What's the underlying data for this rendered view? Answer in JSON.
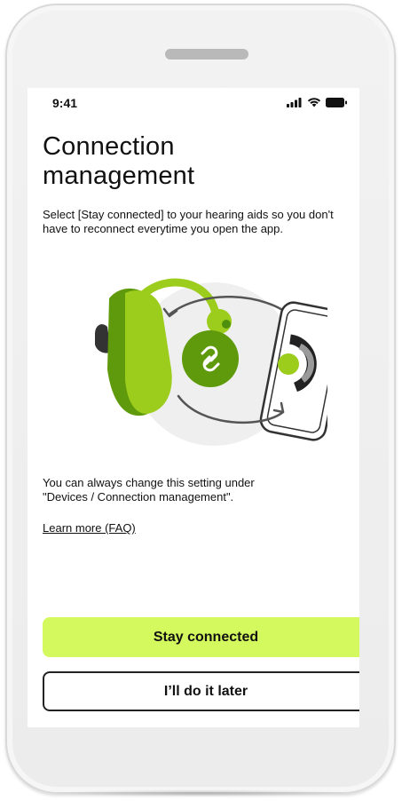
{
  "status_bar": {
    "time": "9:41",
    "icons": [
      "signal-icon",
      "wifi-icon",
      "battery-icon"
    ]
  },
  "page": {
    "title_line1": "Connection",
    "title_line2": "management",
    "description": "Select [Stay connected] to your hearing aids so you don't have to reconnect everytime you open the app.",
    "note_line1": "You can always change this setting under",
    "note_line2": "\"Devices / Connection management\".",
    "faq_link": "Learn more (FAQ)"
  },
  "buttons": {
    "primary": "Stay connected",
    "secondary": "I’ll do it later"
  },
  "colors": {
    "accent": "#d4f95f",
    "hearing_aid_green": "#9ccc1c",
    "hearing_aid_dark_green": "#5f9a0c",
    "link_circle": "#5f9a0c"
  }
}
